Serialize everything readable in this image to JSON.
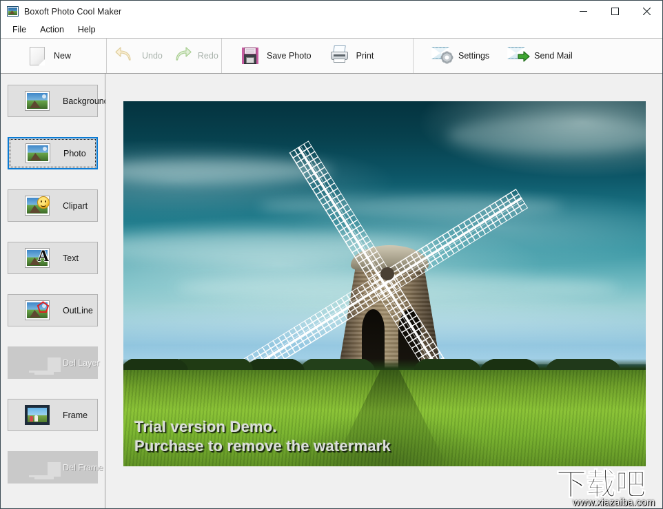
{
  "window": {
    "title": "Boxoft Photo Cool Maker",
    "icon": "photo-frame-icon",
    "controls": {
      "minimize": "minimize-icon",
      "maximize": "maximize-icon",
      "close": "close-icon"
    }
  },
  "menubar": {
    "items": [
      {
        "label": "File"
      },
      {
        "label": "Action"
      },
      {
        "label": "Help"
      }
    ]
  },
  "toolbar": {
    "groups": [
      {
        "buttons": [
          {
            "label": "New",
            "icon": "new-page-icon",
            "enabled": true
          }
        ]
      },
      {
        "buttons": [
          {
            "label": "Undo",
            "icon": "undo-arrow-icon",
            "enabled": false
          },
          {
            "label": "Redo",
            "icon": "redo-arrow-icon",
            "enabled": false
          }
        ]
      },
      {
        "buttons": [
          {
            "label": "Save Photo",
            "icon": "floppy-disk-icon",
            "enabled": true
          },
          {
            "label": "Print",
            "icon": "printer-icon",
            "enabled": true
          }
        ]
      },
      {
        "buttons": [
          {
            "label": "Settings",
            "icon": "envelope-gear-icon",
            "enabled": true
          },
          {
            "label": "Send Mail",
            "icon": "envelope-arrow-icon",
            "enabled": true
          }
        ]
      }
    ]
  },
  "sidebar": {
    "items": [
      {
        "label": "Background",
        "icon": "landscape-thumb-icon",
        "enabled": true,
        "selected": false
      },
      {
        "label": "Photo",
        "icon": "landscape-thumb-icon",
        "enabled": true,
        "selected": true
      },
      {
        "label": "Clipart",
        "icon": "smiley-clipart-icon",
        "enabled": true,
        "selected": false
      },
      {
        "label": "Text",
        "icon": "letter-a-icon",
        "enabled": true,
        "selected": false
      },
      {
        "label": "OutLine",
        "icon": "outline-shape-icon",
        "enabled": true,
        "selected": false
      },
      {
        "label": "Del Layer",
        "icon": "delete-layer-icon",
        "enabled": false,
        "selected": false
      },
      {
        "label": "Frame",
        "icon": "picture-frame-icon",
        "enabled": true,
        "selected": false
      },
      {
        "label": "Del Frame",
        "icon": "delete-frame-icon",
        "enabled": false,
        "selected": false
      }
    ]
  },
  "canvas": {
    "photo": {
      "alt": "windmill-in-green-field-photo",
      "watermark_line1": "Trial version Demo.",
      "watermark_line2": "Purchase to remove the watermark"
    }
  },
  "site_watermark": {
    "logo_text": "下载吧",
    "url": "www.xiazaiba.com"
  },
  "colors": {
    "accent_selected": "#0a7bd4",
    "window_border": "#3a4a52",
    "panel_bg": "#f0f0f0",
    "button_bg": "#e0e0e0",
    "button_disabled_bg": "#c9c9c9",
    "toolbar_bg": "#fbfbfb",
    "text": "#141414",
    "text_disabled": "#a9b3ac"
  }
}
